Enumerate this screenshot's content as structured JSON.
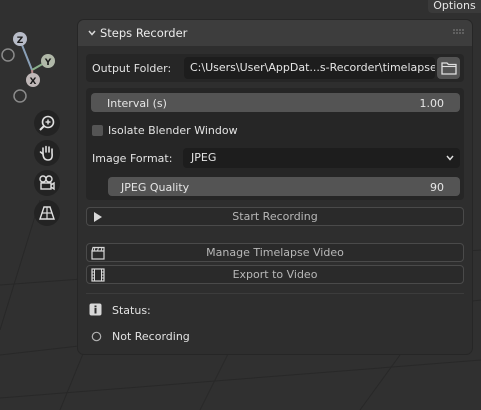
{
  "header": {
    "options_label": "Options"
  },
  "gizmo": {
    "z_label": "Z",
    "y_label": "Y",
    "x_label": "X"
  },
  "nav_icons": [
    "zoom-icon",
    "hand-pan-icon",
    "camera-icon",
    "perspective-grid-icon"
  ],
  "panel": {
    "title": "Steps Recorder",
    "output_folder_label": "Output Folder:",
    "output_folder_value": "C:\\Users\\User\\AppDat...s-Recorder\\timelapse",
    "interval_label": "Interval (s)",
    "interval_value": "1.00",
    "isolate_label": "Isolate Blender Window",
    "isolate_checked": false,
    "image_format_label": "Image Format:",
    "image_format_value": "JPEG",
    "jpeg_quality_label": "JPEG Quality",
    "jpeg_quality_value": "90",
    "start_recording_label": "Start Recording",
    "manage_timelapse_label": "Manage Timelapse Video",
    "export_video_label": "Export to Video",
    "status_label": "Status:",
    "status_value": "Not Recording"
  },
  "colors": {
    "background": "#303030",
    "panel": "#2e2e2e",
    "panel_header": "#3d3d3d",
    "field_dark": "#1d1d1d",
    "field_slider": "#545454",
    "text": "#e6e6e6"
  }
}
